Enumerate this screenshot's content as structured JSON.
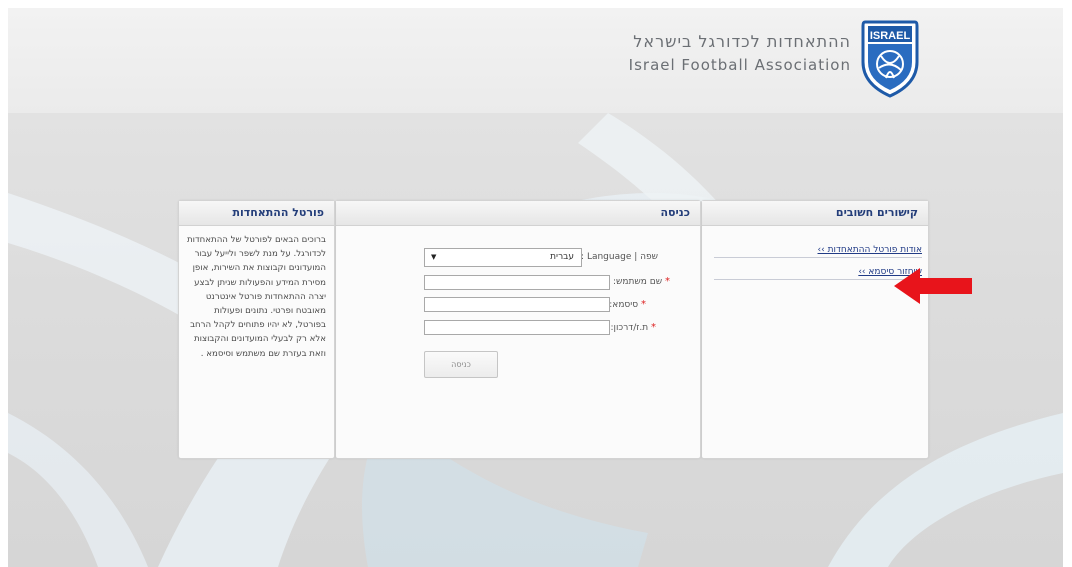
{
  "header": {
    "org_name_he": "ההתאחדות לכדורגל בישראל",
    "org_name_en": "Israel Football Association",
    "logo": {
      "icon": "ifa-shield-logo-icon",
      "text": "ISRAEL",
      "color": "#1e5aa8"
    }
  },
  "links_panel": {
    "title": "קישורים חשובים",
    "items": [
      {
        "label": "אודות פורטל ההתאחדות ››"
      },
      {
        "label": "שיחזור סיסמא ››"
      }
    ]
  },
  "login_panel": {
    "title": "כניסה",
    "language_label": "שפה | Language :",
    "language_value": "עברית",
    "username_label": "שם משתמש:",
    "password_label": "סיסמא:",
    "id_label": "ת.ז/דרכון:",
    "username_value": "",
    "password_value": "",
    "id_value": "",
    "required_mark": "*",
    "submit_label": "כניסה"
  },
  "portal_panel": {
    "title": "פורטל ההתאחדות",
    "text": "ברוכים הבאים לפורטל של ההתאחדות לכדורגל. על מנת לשפר ולייעל עבור המועדונים וקבוצות את השירות, אופן מסירת המידע והפעולות שניתן לבצע יצרה ההתאחדות פורטל אינטרנט מאובטח ופרטי. נתונים ופעולות בפורטל, לא יהיו פתוחים לקהל הרחב אלא רק לבעלי המועדונים והקבוצות וזאת בעזרת שם משתמש וסיסמא ."
  },
  "annotation": {
    "icon": "red-arrow-icon",
    "color": "#e8141b"
  },
  "colors": {
    "link": "#213b86",
    "panel_title": "#243e7a",
    "required": "#dd2222"
  }
}
